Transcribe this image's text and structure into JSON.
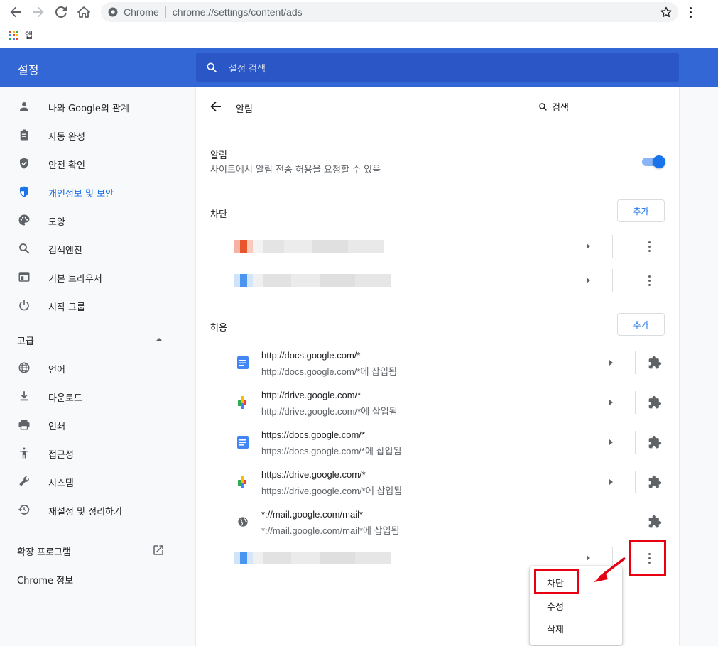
{
  "browser": {
    "site_label": "Chrome",
    "url": "chrome://settings/content/ads",
    "bookmarks_apps": "앱"
  },
  "header": {
    "title": "설정",
    "search_placeholder": "설정 검색"
  },
  "sidebar": {
    "items": [
      {
        "label": "나와 Google의 관계",
        "icon": "person-icon"
      },
      {
        "label": "자동 완성",
        "icon": "clipboard-icon"
      },
      {
        "label": "안전 확인",
        "icon": "shield-check-icon"
      },
      {
        "label": "개인정보 및 보안",
        "icon": "shield-icon",
        "active": true
      },
      {
        "label": "모양",
        "icon": "palette-icon"
      },
      {
        "label": "검색엔진",
        "icon": "search-icon"
      },
      {
        "label": "기본 브라우저",
        "icon": "browser-icon"
      },
      {
        "label": "시작 그룹",
        "icon": "power-icon"
      }
    ],
    "advanced_label": "고급",
    "advanced_items": [
      {
        "label": "언어",
        "icon": "globe-icon"
      },
      {
        "label": "다운로드",
        "icon": "download-icon"
      },
      {
        "label": "인쇄",
        "icon": "printer-icon"
      },
      {
        "label": "접근성",
        "icon": "accessibility-icon"
      },
      {
        "label": "시스템",
        "icon": "wrench-icon"
      },
      {
        "label": "재설정 및 정리하기",
        "icon": "history-icon"
      }
    ],
    "extensions_label": "확장 프로그램",
    "about_label": "Chrome 정보"
  },
  "main": {
    "page_title": "알림",
    "search_text": "검색",
    "option_title": "알림",
    "option_subtitle": "사이트에서 알림 전송 허용을 요청할 수 있음",
    "toggle_on": true,
    "blocked_label": "차단",
    "allowed_label": "허용",
    "add_label": "추가",
    "allowed_sites": [
      {
        "url": "http://docs.google.com/*",
        "sub": "http://docs.google.com/*에 삽입됨",
        "icon": "docs-icon"
      },
      {
        "url": "http://drive.google.com/*",
        "sub": "http://drive.google.com/*에 삽입됨",
        "icon": "drive-icon"
      },
      {
        "url": "https://docs.google.com/*",
        "sub": "https://docs.google.com/*에 삽입됨",
        "icon": "docs-icon"
      },
      {
        "url": "https://drive.google.com/*",
        "sub": "https://drive.google.com/*에 삽입됨",
        "icon": "drive-icon"
      },
      {
        "url": "*://mail.google.com/mail*",
        "sub": "*://mail.google.com/mail*에 삽입됨",
        "icon": "globe-icon"
      }
    ]
  },
  "context_menu": {
    "items": [
      "차단",
      "수정",
      "삭제"
    ]
  },
  "colors": {
    "header_blue": "#3367d6",
    "accent": "#1a73e8",
    "highlight_red": "#e60012"
  }
}
